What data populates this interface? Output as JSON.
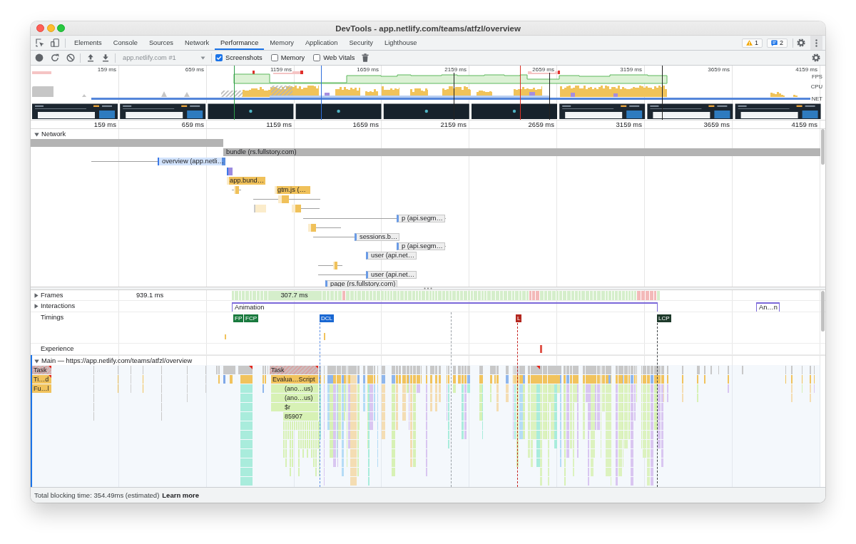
{
  "window": {
    "title": "DevTools - app.netlify.com/teams/atfzl/overview"
  },
  "tabs": [
    {
      "label": "Elements",
      "selected": false
    },
    {
      "label": "Console",
      "selected": false
    },
    {
      "label": "Sources",
      "selected": false
    },
    {
      "label": "Network",
      "selected": false
    },
    {
      "label": "Performance",
      "selected": true
    },
    {
      "label": "Memory",
      "selected": false
    },
    {
      "label": "Application",
      "selected": false
    },
    {
      "label": "Security",
      "selected": false
    },
    {
      "label": "Lighthouse",
      "selected": false
    }
  ],
  "counters": [
    {
      "kind": "warning",
      "count": "1"
    },
    {
      "kind": "message",
      "count": "2"
    }
  ],
  "toolbar": {
    "recording": "app.netlify.com #1",
    "options": [
      {
        "label": "Screenshots",
        "checked": true
      },
      {
        "label": "Memory",
        "checked": false
      },
      {
        "label": "Web Vitals",
        "checked": false
      }
    ]
  },
  "overview": {
    "ticks": [
      "159 ms",
      "659 ms",
      "1159 ms",
      "1659 ms",
      "2159 ms",
      "2659 ms",
      "3159 ms",
      "3659 ms",
      "4159 ms"
    ],
    "lanes": [
      "FPS",
      "CPU",
      "NET"
    ],
    "screenshots": [
      {
        "kind": "loaded"
      },
      {
        "kind": "loaded"
      },
      {
        "kind": "loading"
      },
      {
        "kind": "loading"
      },
      {
        "kind": "loading"
      },
      {
        "kind": "loading"
      },
      {
        "kind": "loaded"
      },
      {
        "kind": "loaded"
      },
      {
        "kind": "loaded"
      }
    ]
  },
  "ruler": {
    "ticks": [
      "159 ms",
      "659 ms",
      "1159 ms",
      "1659 ms",
      "2159 ms",
      "2659 ms",
      "3159 ms",
      "3659 ms",
      "4159 ms"
    ]
  },
  "network": {
    "title": "Network",
    "expanded": true,
    "requests": [
      {
        "label": "bundle (rs.fullstory.com)",
        "kind": "other"
      },
      {
        "label": "overview (app.netli…",
        "kind": "document"
      },
      {
        "label": "app.bund…",
        "kind": "script"
      },
      {
        "label": "gtm.js (…",
        "kind": "script"
      },
      {
        "label": "p (api.segm…",
        "kind": "xhr"
      },
      {
        "label": "sessions.b…",
        "kind": "xhr"
      },
      {
        "label": "p (api.segm…",
        "kind": "xhr"
      },
      {
        "label": "user (api.net…",
        "kind": "xhr"
      },
      {
        "label": "user (api.net…",
        "kind": "xhr"
      },
      {
        "label": "page (rs.fullstory.com)",
        "kind": "xhr"
      }
    ]
  },
  "frames": {
    "title": "Frames",
    "expanded": false,
    "items": [
      {
        "label": "939.1 ms",
        "kind": "idle"
      },
      {
        "label": "307.7 ms",
        "kind": "rendered"
      }
    ]
  },
  "interactions": {
    "title": "Interactions",
    "expanded": false,
    "items": [
      "Animation",
      "An…n"
    ]
  },
  "timings": {
    "title": "Timings",
    "markers": [
      {
        "label": "FP",
        "color": "#197a3e"
      },
      {
        "label": "FCP",
        "color": "#197a3e"
      },
      {
        "label": "DCL",
        "color": "#1967d2"
      },
      {
        "label": "L",
        "color": "#b3261e"
      },
      {
        "label": "LCP",
        "color": "#1e3a2b"
      }
    ]
  },
  "experience": {
    "title": "Experience"
  },
  "main": {
    "title": "Main — https://app.netlify.com/teams/atfzl/overview",
    "expanded": true,
    "events": [
      {
        "label": "Task",
        "kind": "task",
        "warning": true
      },
      {
        "label": "Ti…d",
        "kind": "scripting",
        "warning": true
      },
      {
        "label": "Fu…l",
        "kind": "scripting",
        "warning": false
      },
      {
        "label": "Task",
        "kind": "task",
        "warning": true
      },
      {
        "label": "Evalua…Script",
        "kind": "scripting",
        "warning": false
      },
      {
        "label": "(ano…us)",
        "kind": "call",
        "warning": false
      },
      {
        "label": "(ano…us)",
        "kind": "call",
        "warning": false
      },
      {
        "label": "$r",
        "kind": "call",
        "warning": false
      },
      {
        "label": "85907",
        "kind": "call",
        "warning": false
      }
    ]
  },
  "status_bar": {
    "text": "Total blocking time: 354.49ms (estimated)",
    "link": "Learn more"
  }
}
